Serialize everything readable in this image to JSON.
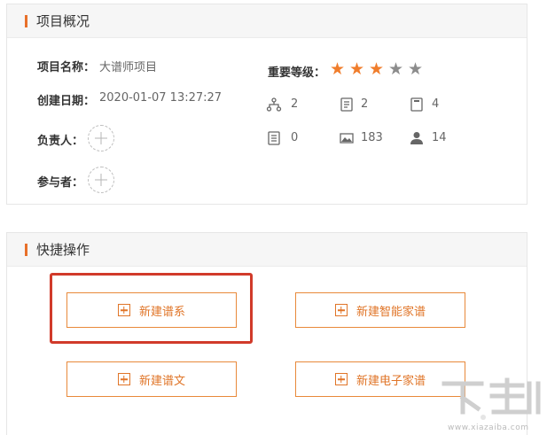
{
  "overview": {
    "title": "项目概况",
    "project_name_label": "项目名称：",
    "project_name_value": "大谱师项目",
    "created_label": "创建日期：",
    "created_value": "2020-01-07 13:27:27",
    "owner_label": "负责人：",
    "participants_label": "参与者：",
    "importance_label": "重要等级：",
    "importance_rating": 3,
    "importance_max": 5,
    "star_filled_color": "#f07d2c",
    "star_empty_color": "#8c8c8c",
    "stats": [
      {
        "icon": "hierarchy-icon",
        "value": "2"
      },
      {
        "icon": "document-icon",
        "value": "2"
      },
      {
        "icon": "book-icon",
        "value": "4"
      },
      {
        "icon": "list-icon",
        "value": "0"
      },
      {
        "icon": "image-icon",
        "value": "183"
      },
      {
        "icon": "user-icon",
        "value": "14"
      }
    ]
  },
  "quick": {
    "title": "快捷操作",
    "buttons": [
      {
        "label": "新建谱系",
        "icon": "plus-square-icon"
      },
      {
        "label": "新建智能家谱",
        "icon": "plus-square-icon"
      },
      {
        "label": "新建谱文",
        "icon": "plus-square-icon"
      },
      {
        "label": "新建电子家谱",
        "icon": "plus-square-icon"
      }
    ],
    "accent_color": "#e07528",
    "highlight_color": "#d13a2a"
  },
  "watermark": {
    "site": "www.xiazaiba.com"
  }
}
